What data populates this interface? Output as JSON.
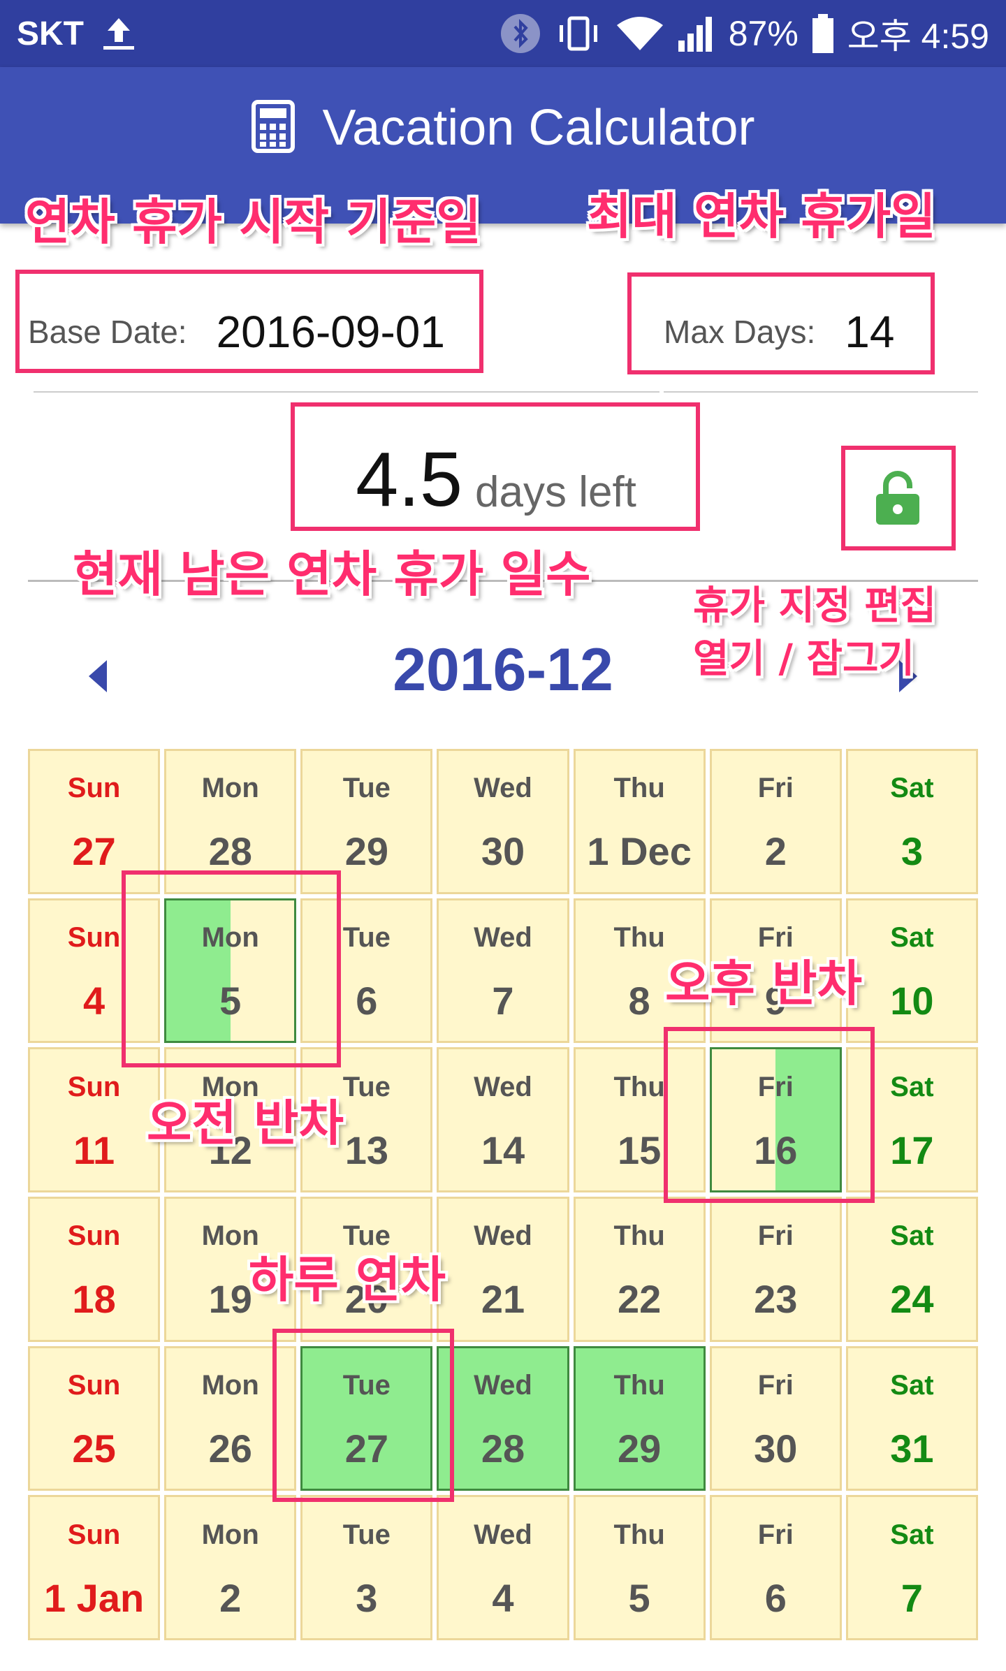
{
  "status_bar": {
    "carrier": "SKT",
    "battery_percent": "87%",
    "time": "오후 4:59"
  },
  "app_bar": {
    "title": "Vacation Calculator",
    "icon": "calculator-icon"
  },
  "fields": {
    "base_date_label": "Base Date:",
    "base_date_value": "2016-09-01",
    "max_days_label": "Max Days:",
    "max_days_value": "14"
  },
  "summary": {
    "days_left_value": "4.5",
    "days_left_suffix": "days left",
    "lock_icon": "unlocked-padlock-icon"
  },
  "month_nav": {
    "title": "2016-12"
  },
  "annotations": {
    "base_date": "연차 휴가 시작 기준일",
    "max_days": "최대 연차 휴가일",
    "days_left": "현재 남은 연차 휴가 일수",
    "lock_line1": "휴가 지정 편집",
    "lock_line2": "열기 / 잠그기",
    "am_half": "오전 반차",
    "pm_half": "오후 반차",
    "full_day": "하루 연차"
  },
  "colors": {
    "app_bar": "#3f51b5",
    "status_bar": "#303f9f",
    "cell_bg": "#fff7cc",
    "vacation_fill": "#8fec8f",
    "sunday": "#e01b1b",
    "saturday": "#138a13",
    "annotation": "#ff2d6e"
  },
  "calendar": {
    "weeks": [
      [
        {
          "day": "Sun",
          "num": "27"
        },
        {
          "day": "Mon",
          "num": "28"
        },
        {
          "day": "Tue",
          "num": "29"
        },
        {
          "day": "Wed",
          "num": "30"
        },
        {
          "day": "Thu",
          "num": "1 Dec"
        },
        {
          "day": "Fri",
          "num": "2"
        },
        {
          "day": "Sat",
          "num": "3"
        }
      ],
      [
        {
          "day": "Sun",
          "num": "4"
        },
        {
          "day": "Mon",
          "num": "5",
          "vacation": "am"
        },
        {
          "day": "Tue",
          "num": "6"
        },
        {
          "day": "Wed",
          "num": "7"
        },
        {
          "day": "Thu",
          "num": "8"
        },
        {
          "day": "Fri",
          "num": "9"
        },
        {
          "day": "Sat",
          "num": "10"
        }
      ],
      [
        {
          "day": "Sun",
          "num": "11"
        },
        {
          "day": "Mon",
          "num": "12"
        },
        {
          "day": "Tue",
          "num": "13"
        },
        {
          "day": "Wed",
          "num": "14"
        },
        {
          "day": "Thu",
          "num": "15"
        },
        {
          "day": "Fri",
          "num": "16",
          "vacation": "pm"
        },
        {
          "day": "Sat",
          "num": "17"
        }
      ],
      [
        {
          "day": "Sun",
          "num": "18"
        },
        {
          "day": "Mon",
          "num": "19"
        },
        {
          "day": "Tue",
          "num": "20"
        },
        {
          "day": "Wed",
          "num": "21"
        },
        {
          "day": "Thu",
          "num": "22"
        },
        {
          "day": "Fri",
          "num": "23"
        },
        {
          "day": "Sat",
          "num": "24"
        }
      ],
      [
        {
          "day": "Sun",
          "num": "25"
        },
        {
          "day": "Mon",
          "num": "26"
        },
        {
          "day": "Tue",
          "num": "27",
          "vacation": "full"
        },
        {
          "day": "Wed",
          "num": "28",
          "vacation": "full"
        },
        {
          "day": "Thu",
          "num": "29",
          "vacation": "full"
        },
        {
          "day": "Fri",
          "num": "30"
        },
        {
          "day": "Sat",
          "num": "31"
        }
      ],
      [
        {
          "day": "Sun",
          "num": "1 Jan"
        },
        {
          "day": "Mon",
          "num": "2"
        },
        {
          "day": "Tue",
          "num": "3"
        },
        {
          "day": "Wed",
          "num": "4"
        },
        {
          "day": "Thu",
          "num": "5"
        },
        {
          "day": "Fri",
          "num": "6"
        },
        {
          "day": "Sat",
          "num": "7"
        }
      ]
    ]
  }
}
